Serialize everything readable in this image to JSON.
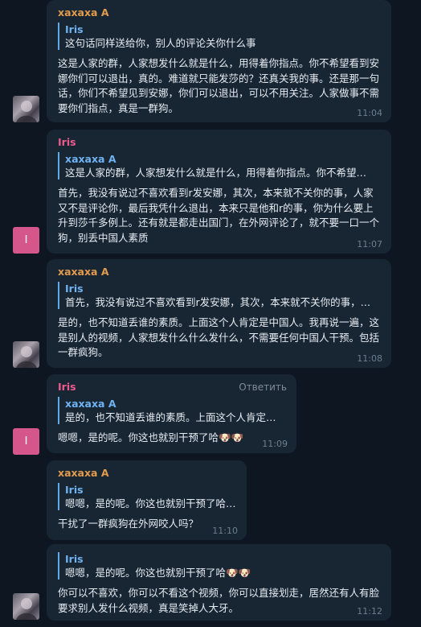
{
  "messages": [
    {
      "sender": "xaxaxa A",
      "quote_name": "Iris",
      "quote_text": "这句话同样送给你，别人的评论关你什么事",
      "text": "这是人家的群，人家想发什么就是什么，用得着你指点。你不希望看到安娜你们可以退出，真的。难道就只能发莎的？还真关我的事。还是那一句话，你们不希望见到安娜，你们可以退出，可以不用关注。人家做事不需要你们指点，真是一群狗。",
      "time": "11:04",
      "avatar": "photo"
    },
    {
      "sender": "Iris",
      "quote_name": "xaxaxa A",
      "quote_text": "这是人家的群，人家想发什么就是什么，用得着你指点。你不希望…",
      "text": "首先，我没有说过不喜欢看到r发安娜，其次，本来就不关你的事，人家又不是评论你，最后我凭什么退出，本来只是他和r的事，你为什么要上升到莎千多例上。还有就是都走出国门，在外网评论了，就不要一口一个狗，别丢中国人素质",
      "time": "11:07",
      "avatar": "I"
    },
    {
      "sender": "xaxaxa A",
      "quote_name": "Iris",
      "quote_text": "首先，我没有说过不喜欢看到r发安娜，其次，本来就不关你的事，…",
      "text": "是的，也不知道丢谁的素质。上面这个人肯定是中国人。我再说一遍，这是别人的视频，人家想发什么什么发什么，不需要任何中国人干预。包括一群疯狗。",
      "time": "11:08",
      "avatar": "photo"
    },
    {
      "sender": "Iris",
      "reply_label": "Ответить",
      "quote_name": "xaxaxa A",
      "quote_text": "是的，也不知道丢谁的素质。上面这个人肯定…",
      "text": "嗯嗯，是的呢。你这也就别干预了哈🐶🐶",
      "time": "11:09",
      "avatar": "I"
    },
    {
      "sender": "xaxaxa A",
      "quote_name": "Iris",
      "quote_text": "嗯嗯，是的呢。你这也就别干预了哈…",
      "text": "干扰了一群疯狗在外网咬人吗？",
      "time": "11:10"
    },
    {
      "quote_name": "Iris",
      "quote_text": "嗯嗯，是的呢。你这也就别干预了哈🐶🐶",
      "text": "你可以不喜欢，你可以不看这个视频，你可以直接划走，居然还有人有脸要求别人发什么视频，真是笑掉人大牙。",
      "time": "11:12",
      "avatar": "photo"
    }
  ]
}
